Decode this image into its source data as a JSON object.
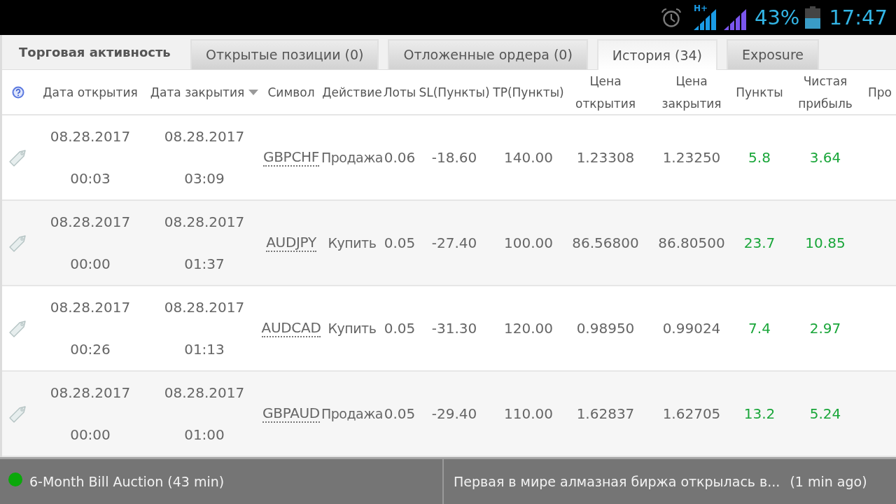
{
  "status_bar": {
    "network_type": "H+",
    "battery": "43%",
    "time": "17:47"
  },
  "title": "Торговая активность",
  "tabs": [
    {
      "label": "Открытые позиции (0)",
      "selected": false
    },
    {
      "label": "Отложенные ордера (0)",
      "selected": false
    },
    {
      "label": "История (34)",
      "selected": true
    },
    {
      "label": "Exposure",
      "selected": false
    }
  ],
  "table": {
    "columns": [
      {
        "label": "Дата открытия",
        "sorted": false
      },
      {
        "label": "Дата закрытия",
        "sorted": true
      },
      {
        "label": "Символ",
        "sorted": false
      },
      {
        "label": "Действие",
        "sorted": false
      },
      {
        "label": "Лоты",
        "sorted": false
      },
      {
        "label": "SL(Пункты)",
        "sorted": false
      },
      {
        "label": "TP(Пункты)",
        "sorted": false
      },
      {
        "label": "Цена открытия",
        "sorted": false
      },
      {
        "label": "Цена закрытия",
        "sorted": false
      },
      {
        "label": "Пункты",
        "sorted": false
      },
      {
        "label": "Чистая прибыль",
        "sorted": false
      },
      {
        "label": "Про",
        "sorted": false
      }
    ],
    "rows": [
      {
        "open_date": "08.28.2017",
        "open_time": "00:03",
        "close_date": "08.28.2017",
        "close_time": "03:09",
        "symbol": "GBPCHF",
        "action": "Продажа",
        "lots": "0.06",
        "sl": "-18.60",
        "tp": "140.00",
        "open_price": "1.23308",
        "close_price": "1.23250",
        "points": "5.8",
        "net_profit": "3.64",
        "profitable": true
      },
      {
        "open_date": "08.28.2017",
        "open_time": "00:00",
        "close_date": "08.28.2017",
        "close_time": "01:37",
        "symbol": "AUDJPY",
        "action": "Купить",
        "lots": "0.05",
        "sl": "-27.40",
        "tp": "100.00",
        "open_price": "86.56800",
        "close_price": "86.80500",
        "points": "23.7",
        "net_profit": "10.85",
        "profitable": true
      },
      {
        "open_date": "08.28.2017",
        "open_time": "00:26",
        "close_date": "08.28.2017",
        "close_time": "01:13",
        "symbol": "AUDCAD",
        "action": "Купить",
        "lots": "0.05",
        "sl": "-31.30",
        "tp": "120.00",
        "open_price": "0.98950",
        "close_price": "0.99024",
        "points": "7.4",
        "net_profit": "2.97",
        "profitable": true
      },
      {
        "open_date": "08.28.2017",
        "open_time": "00:00",
        "close_date": "08.28.2017",
        "close_time": "01:00",
        "symbol": "GBPAUD",
        "action": "Продажа",
        "lots": "0.05",
        "sl": "-29.40",
        "tp": "110.00",
        "open_price": "1.62837",
        "close_price": "1.62705",
        "points": "13.2",
        "net_profit": "5.24",
        "profitable": true
      }
    ]
  },
  "news_bar": {
    "event": "6-Month Bill Auction (43 min)",
    "headline": "Первая в мире алмазная биржа открылась в...",
    "headline_time": "(1 min ago)"
  }
}
